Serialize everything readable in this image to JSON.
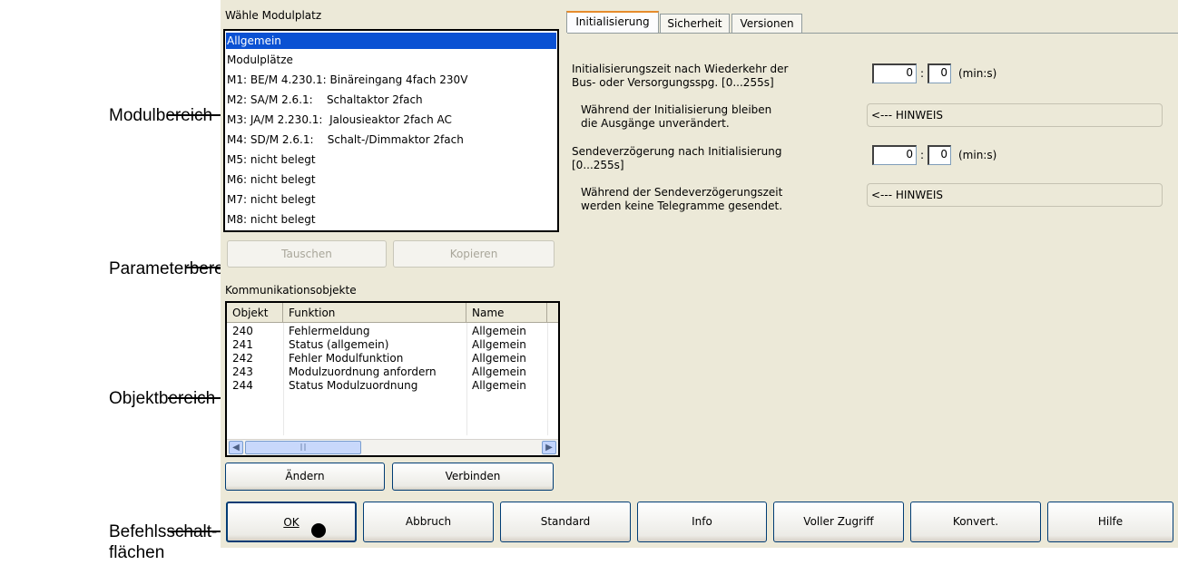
{
  "annotations": {
    "modulbereich": "Modulbereich",
    "parameterbereich": "Parameterbereich",
    "objektbereich": "Objektbereich",
    "befehls_1": "Befehlsschalt-",
    "befehls_2": "flächen"
  },
  "module_section": {
    "label": "Wähle Modulplatz",
    "items": [
      {
        "label": "Allgemein",
        "selected": true
      },
      {
        "label": "Modulplätze"
      },
      {
        "label": "M1: BE/M 4.230.1: Binäreingang 4fach 230V"
      },
      {
        "label": "M2: SA/M 2.6.1:    Schaltaktor 2fach"
      },
      {
        "label": "M3: JA/M 2.230.1:  Jalousieaktor 2fach AC"
      },
      {
        "label": "M4: SD/M 2.6.1:    Schalt-/Dimmaktor 2fach"
      },
      {
        "label": "M5: nicht belegt"
      },
      {
        "label": "M6: nicht belegt"
      },
      {
        "label": "M7: nicht belegt"
      },
      {
        "label": "M8: nicht belegt"
      }
    ],
    "swap_button": "Tauschen",
    "copy_button": "Kopieren"
  },
  "tabs": [
    {
      "label": "Initialisierung",
      "active": true
    },
    {
      "label": "Sicherheit"
    },
    {
      "label": "Versionen"
    }
  ],
  "parameters": {
    "init_time_label_1": "Initialisierungszeit nach Wiederkehr der",
    "init_time_label_2": "Bus- oder Versorgungsspg. [0...255s]",
    "init_time_min": "0",
    "init_time_sec": "0",
    "init_time_unit": "(min:s)",
    "init_note_1": "Während der Initialisierung bleiben",
    "init_note_2": "die Ausgänge unverändert.",
    "init_hint": "<--- HINWEIS",
    "send_delay_label_1": "Sendeverzögerung nach Initialisierung",
    "send_delay_label_2": "[0...255s]",
    "send_delay_min": "0",
    "send_delay_sec": "0",
    "send_delay_unit": "(min:s)",
    "send_note_1": "Während der Sendeverzögerungszeit",
    "send_note_2": "werden keine Telegramme gesendet.",
    "send_hint": "<--- HINWEIS",
    "separator": ":"
  },
  "objects": {
    "label": "Kommunikationsobjekte",
    "columns": [
      "Objekt",
      "Funktion",
      "Name"
    ],
    "rows": [
      [
        "240",
        "Fehlermeldung",
        "Allgemein"
      ],
      [
        "241",
        "Status (allgemein)",
        "Allgemein"
      ],
      [
        "242",
        "Fehler Modulfunktion",
        "Allgemein"
      ],
      [
        "243",
        "Modulzuordnung anfordern",
        "Allgemein"
      ],
      [
        "244",
        "Status Modulzuordnung",
        "Allgemein"
      ]
    ],
    "change_button": "Ändern",
    "connect_button": "Verbinden"
  },
  "command_buttons": {
    "ok": "OK",
    "cancel": "Abbruch",
    "standard": "Standard",
    "info": "Info",
    "full_access": "Voller Zugriff",
    "convert": "Konvert.",
    "help": "Hilfe"
  }
}
